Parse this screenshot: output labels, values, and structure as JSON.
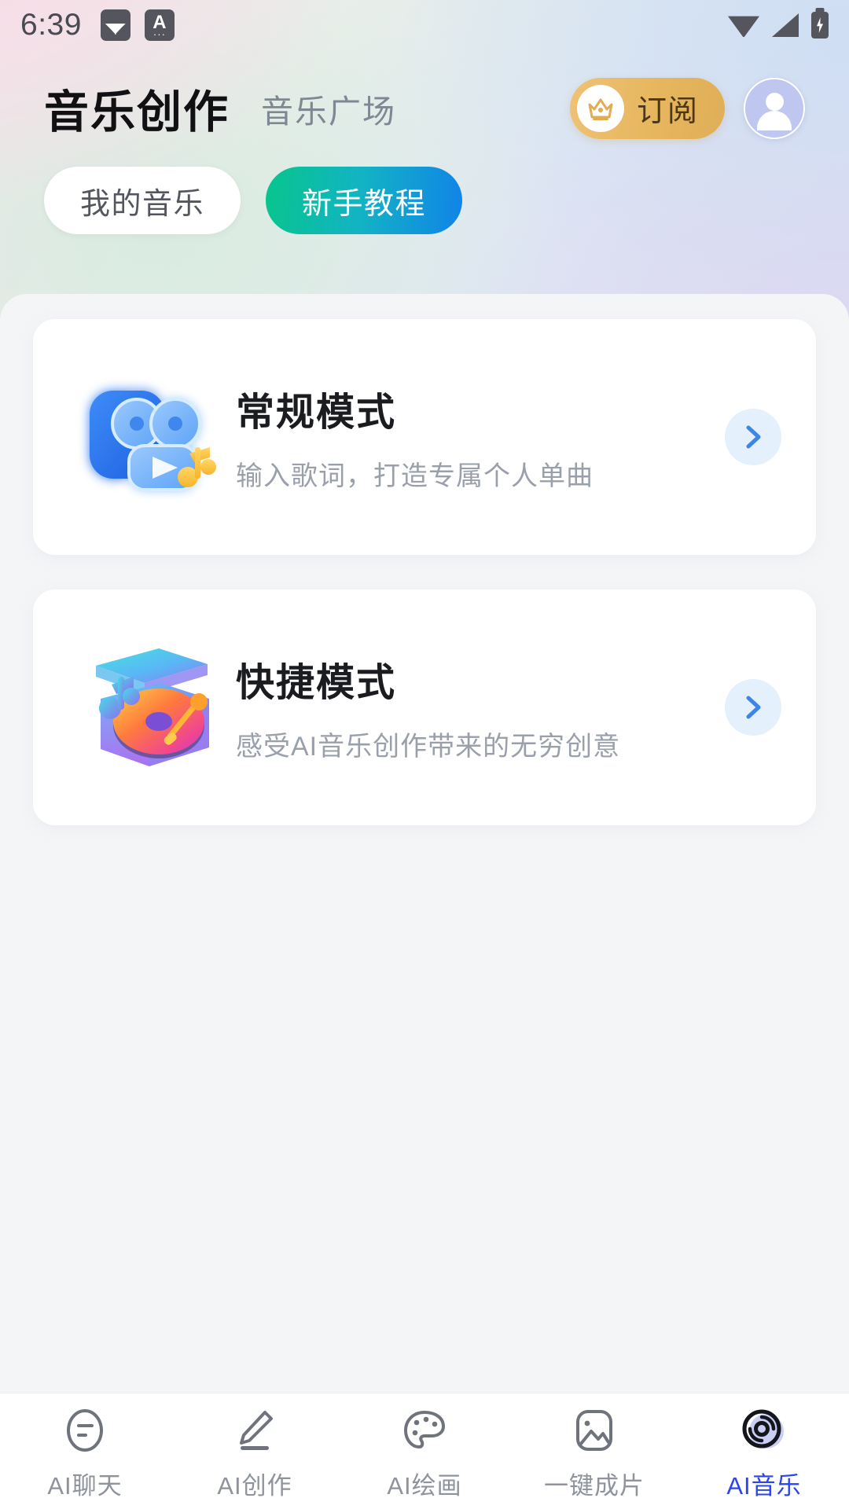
{
  "status_bar": {
    "time": "6:39",
    "left_icons": [
      "screenshot-image-icon",
      "keyboard-a-icon"
    ],
    "right_icons": [
      "wifi-icon",
      "cellular-signal-icon",
      "battery-charging-icon"
    ]
  },
  "header": {
    "title": "音乐创作",
    "secondary_title": "音乐广场",
    "subscribe_label": "订阅",
    "subscribe_icon": "crown-icon",
    "avatar_icon": "user-avatar-icon",
    "subscribe_color": "#e7b75f"
  },
  "tabs": [
    {
      "label": "我的音乐",
      "active": false
    },
    {
      "label": "新手教程",
      "active": true
    }
  ],
  "tab_active_gradient": [
    "#07c58c",
    "#1183e8"
  ],
  "cards": [
    {
      "title": "常规模式",
      "subtitle": "输入歌词，打造专属个人单曲",
      "icon": "blue-projector-music-icon",
      "chevron": "chevron-right-icon"
    },
    {
      "title": "快捷模式",
      "subtitle": "感受AI音乐创作带来的无穷创意",
      "icon": "colorful-turntable-icon",
      "chevron": "chevron-right-icon"
    }
  ],
  "bottom_nav": {
    "active_color": "#2c44e8",
    "inactive_color": "#8e939c",
    "items": [
      {
        "label": "AI聊天",
        "icon": "chat-bubble-icon",
        "active": false
      },
      {
        "label": "AI创作",
        "icon": "pencil-icon",
        "active": false
      },
      {
        "label": "AI绘画",
        "icon": "palette-icon",
        "active": false
      },
      {
        "label": "一键成片",
        "icon": "image-photo-icon",
        "active": false
      },
      {
        "label": "AI音乐",
        "icon": "vinyl-disc-icon",
        "active": true
      }
    ]
  }
}
